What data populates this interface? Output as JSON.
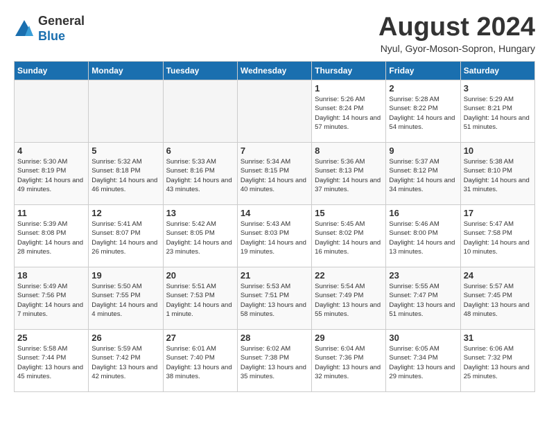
{
  "logo": {
    "general": "General",
    "blue": "Blue"
  },
  "title": "August 2024",
  "location": "Nyul, Gyor-Moson-Sopron, Hungary",
  "headers": [
    "Sunday",
    "Monday",
    "Tuesday",
    "Wednesday",
    "Thursday",
    "Friday",
    "Saturday"
  ],
  "weeks": [
    [
      {
        "day": "",
        "empty": true
      },
      {
        "day": "",
        "empty": true
      },
      {
        "day": "",
        "empty": true
      },
      {
        "day": "",
        "empty": true
      },
      {
        "day": "1",
        "info": "Sunrise: 5:26 AM\nSunset: 8:24 PM\nDaylight: 14 hours\nand 57 minutes."
      },
      {
        "day": "2",
        "info": "Sunrise: 5:28 AM\nSunset: 8:22 PM\nDaylight: 14 hours\nand 54 minutes."
      },
      {
        "day": "3",
        "info": "Sunrise: 5:29 AM\nSunset: 8:21 PM\nDaylight: 14 hours\nand 51 minutes."
      }
    ],
    [
      {
        "day": "4",
        "info": "Sunrise: 5:30 AM\nSunset: 8:19 PM\nDaylight: 14 hours\nand 49 minutes."
      },
      {
        "day": "5",
        "info": "Sunrise: 5:32 AM\nSunset: 8:18 PM\nDaylight: 14 hours\nand 46 minutes."
      },
      {
        "day": "6",
        "info": "Sunrise: 5:33 AM\nSunset: 8:16 PM\nDaylight: 14 hours\nand 43 minutes."
      },
      {
        "day": "7",
        "info": "Sunrise: 5:34 AM\nSunset: 8:15 PM\nDaylight: 14 hours\nand 40 minutes."
      },
      {
        "day": "8",
        "info": "Sunrise: 5:36 AM\nSunset: 8:13 PM\nDaylight: 14 hours\nand 37 minutes."
      },
      {
        "day": "9",
        "info": "Sunrise: 5:37 AM\nSunset: 8:12 PM\nDaylight: 14 hours\nand 34 minutes."
      },
      {
        "day": "10",
        "info": "Sunrise: 5:38 AM\nSunset: 8:10 PM\nDaylight: 14 hours\nand 31 minutes."
      }
    ],
    [
      {
        "day": "11",
        "info": "Sunrise: 5:39 AM\nSunset: 8:08 PM\nDaylight: 14 hours\nand 28 minutes."
      },
      {
        "day": "12",
        "info": "Sunrise: 5:41 AM\nSunset: 8:07 PM\nDaylight: 14 hours\nand 26 minutes."
      },
      {
        "day": "13",
        "info": "Sunrise: 5:42 AM\nSunset: 8:05 PM\nDaylight: 14 hours\nand 23 minutes."
      },
      {
        "day": "14",
        "info": "Sunrise: 5:43 AM\nSunset: 8:03 PM\nDaylight: 14 hours\nand 19 minutes."
      },
      {
        "day": "15",
        "info": "Sunrise: 5:45 AM\nSunset: 8:02 PM\nDaylight: 14 hours\nand 16 minutes."
      },
      {
        "day": "16",
        "info": "Sunrise: 5:46 AM\nSunset: 8:00 PM\nDaylight: 14 hours\nand 13 minutes."
      },
      {
        "day": "17",
        "info": "Sunrise: 5:47 AM\nSunset: 7:58 PM\nDaylight: 14 hours\nand 10 minutes."
      }
    ],
    [
      {
        "day": "18",
        "info": "Sunrise: 5:49 AM\nSunset: 7:56 PM\nDaylight: 14 hours\nand 7 minutes."
      },
      {
        "day": "19",
        "info": "Sunrise: 5:50 AM\nSunset: 7:55 PM\nDaylight: 14 hours\nand 4 minutes."
      },
      {
        "day": "20",
        "info": "Sunrise: 5:51 AM\nSunset: 7:53 PM\nDaylight: 14 hours\nand 1 minute."
      },
      {
        "day": "21",
        "info": "Sunrise: 5:53 AM\nSunset: 7:51 PM\nDaylight: 13 hours\nand 58 minutes."
      },
      {
        "day": "22",
        "info": "Sunrise: 5:54 AM\nSunset: 7:49 PM\nDaylight: 13 hours\nand 55 minutes."
      },
      {
        "day": "23",
        "info": "Sunrise: 5:55 AM\nSunset: 7:47 PM\nDaylight: 13 hours\nand 51 minutes."
      },
      {
        "day": "24",
        "info": "Sunrise: 5:57 AM\nSunset: 7:45 PM\nDaylight: 13 hours\nand 48 minutes."
      }
    ],
    [
      {
        "day": "25",
        "info": "Sunrise: 5:58 AM\nSunset: 7:44 PM\nDaylight: 13 hours\nand 45 minutes."
      },
      {
        "day": "26",
        "info": "Sunrise: 5:59 AM\nSunset: 7:42 PM\nDaylight: 13 hours\nand 42 minutes."
      },
      {
        "day": "27",
        "info": "Sunrise: 6:01 AM\nSunset: 7:40 PM\nDaylight: 13 hours\nand 38 minutes."
      },
      {
        "day": "28",
        "info": "Sunrise: 6:02 AM\nSunset: 7:38 PM\nDaylight: 13 hours\nand 35 minutes."
      },
      {
        "day": "29",
        "info": "Sunrise: 6:04 AM\nSunset: 7:36 PM\nDaylight: 13 hours\nand 32 minutes."
      },
      {
        "day": "30",
        "info": "Sunrise: 6:05 AM\nSunset: 7:34 PM\nDaylight: 13 hours\nand 29 minutes."
      },
      {
        "day": "31",
        "info": "Sunrise: 6:06 AM\nSunset: 7:32 PM\nDaylight: 13 hours\nand 25 minutes."
      }
    ]
  ]
}
